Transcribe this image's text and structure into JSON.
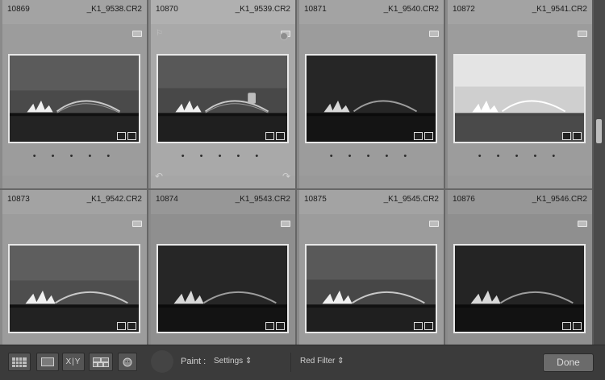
{
  "grid": {
    "cells": [
      {
        "index": "10869",
        "file": "_K1_9538.CR2",
        "dots": "• • • • •"
      },
      {
        "index": "10870",
        "file": "_K1_9539.CR2",
        "dots": "• • • • •"
      },
      {
        "index": "10871",
        "file": "_K1_9540.CR2",
        "dots": "• • • • •"
      },
      {
        "index": "10872",
        "file": "_K1_9541.CR2",
        "dots": "• • • • •"
      },
      {
        "index": "10873",
        "file": "_K1_9542.CR2"
      },
      {
        "index": "10874",
        "file": "_K1_9543.CR2"
      },
      {
        "index": "10875",
        "file": "_K1_9545.CR2"
      },
      {
        "index": "10876",
        "file": "_K1_9546.CR2"
      }
    ]
  },
  "toolbar": {
    "view_buttons": [
      {
        "name": "grid-view-icon"
      },
      {
        "name": "loupe-view-icon"
      },
      {
        "name": "compare-view-icon",
        "label": "X|Y"
      },
      {
        "name": "survey-view-icon"
      },
      {
        "name": "people-view-icon"
      }
    ],
    "paint_label": "Paint :",
    "settings_value": "Settings",
    "filter_value": "Red Filter",
    "done_label": "Done"
  },
  "colors": {
    "toolbar_bg": "#3b3b3b",
    "cell_bg": "#9c9c9c",
    "thumb_border": "#e8e8e8"
  }
}
